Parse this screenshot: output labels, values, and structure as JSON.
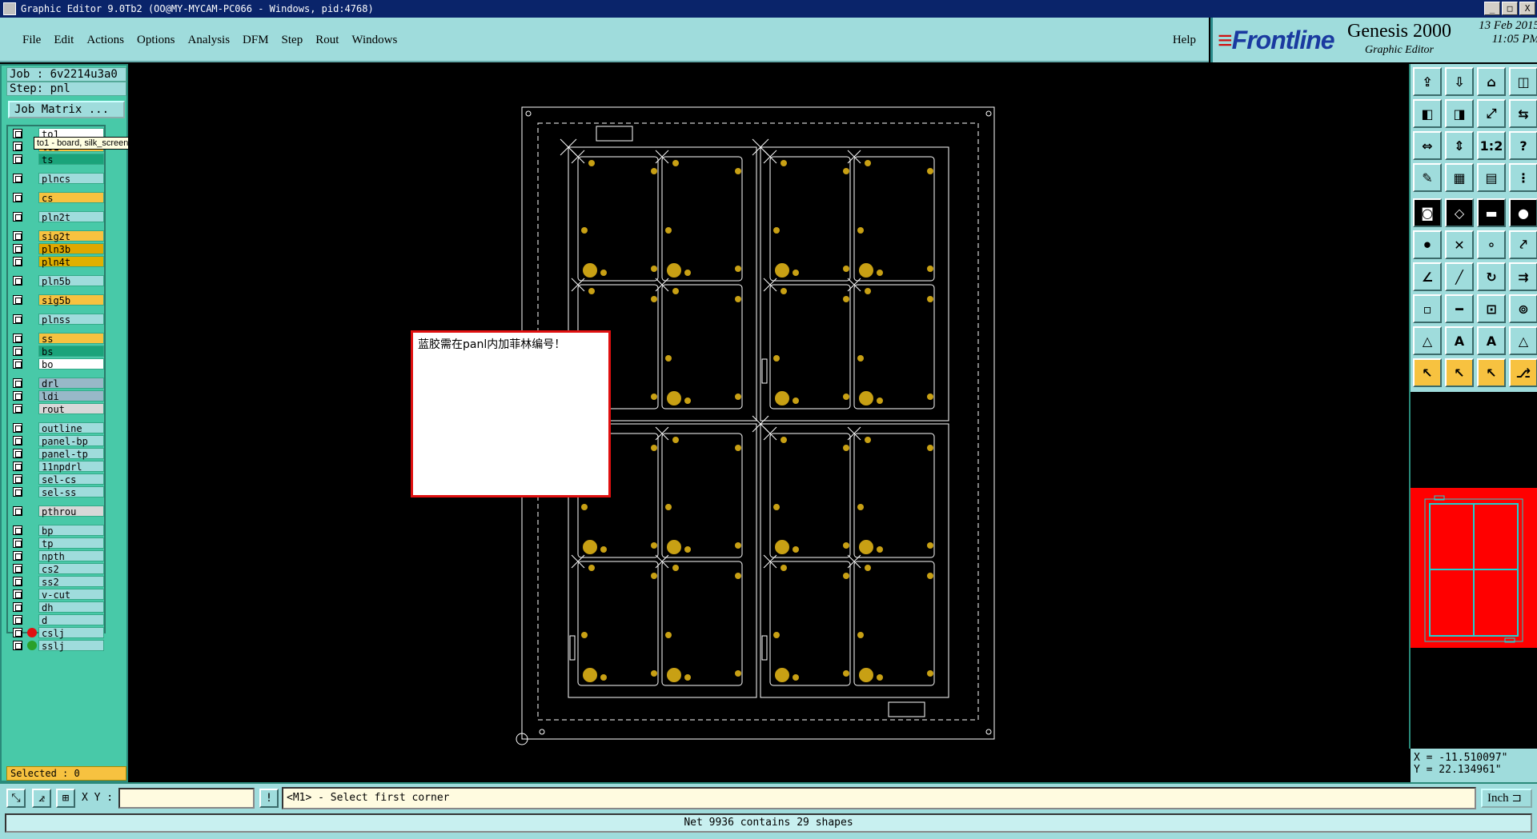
{
  "window": {
    "title": "Graphic Editor 9.0Tb2 (OO@MY-MYCAM-PC066 - Windows, pid:4768)",
    "controls": [
      "_",
      "□",
      "X"
    ]
  },
  "menu": {
    "items": [
      "File",
      "Edit",
      "Actions",
      "Options",
      "Analysis",
      "DFM",
      "Step",
      "Rout",
      "Windows"
    ],
    "help": "Help"
  },
  "brand": {
    "logo": "Frontline",
    "product": "Genesis 2000",
    "subtitle": "Graphic Editor",
    "date": "13 Feb 2015",
    "time": "11:05 PM"
  },
  "job": {
    "job_label": "Job : 6v2214u3a0",
    "step_label": "Step: pnl",
    "matrix_button": "Job Matrix ..."
  },
  "layers": [
    {
      "name": "to1",
      "color": "#ffffff",
      "gap": 0
    },
    {
      "name": "to1",
      "color": "#f7c240",
      "gap": 0
    },
    {
      "name": "ts",
      "color": "#1aa37a",
      "gap": 0
    },
    {
      "name": "plncs",
      "color": "#9fdcdc",
      "gap": 4
    },
    {
      "name": "cs",
      "color": "#f7c240",
      "gap": 4
    },
    {
      "name": "pln2t",
      "color": "#9fdcdc",
      "gap": 4
    },
    {
      "name": "sig2t",
      "color": "#f7c240",
      "gap": 4
    },
    {
      "name": "pln3b",
      "color": "#e0a800",
      "gap": 0
    },
    {
      "name": "pln4t",
      "color": "#e0b000",
      "gap": 0
    },
    {
      "name": "pln5b",
      "color": "#9fdcdc",
      "gap": 4
    },
    {
      "name": "sig5b",
      "color": "#f7c240",
      "gap": 4
    },
    {
      "name": "plnss",
      "color": "#9fdcdc",
      "gap": 4
    },
    {
      "name": "ss",
      "color": "#f7c240",
      "gap": 4
    },
    {
      "name": "bs",
      "color": "#1aa37a",
      "gap": 0
    },
    {
      "name": "bo",
      "color": "#ffffff",
      "gap": 0
    },
    {
      "name": "drl",
      "color": "#98b8c8",
      "gap": 4
    },
    {
      "name": "ldi",
      "color": "#98b8c8",
      "gap": 0
    },
    {
      "name": "rout",
      "color": "#d8d8d8",
      "gap": 0
    },
    {
      "name": "outline",
      "color": "#9fdcdc",
      "gap": 4
    },
    {
      "name": "panel-bp",
      "color": "#9fdcdc",
      "gap": 0
    },
    {
      "name": "panel-tp",
      "color": "#9fdcdc",
      "gap": 0
    },
    {
      "name": "11npdrl",
      "color": "#9fdcdc",
      "gap": 0
    },
    {
      "name": "sel-cs",
      "color": "#9fdcdc",
      "gap": 0
    },
    {
      "name": "sel-ss",
      "color": "#9fdcdc",
      "gap": 0
    },
    {
      "name": "pthrou",
      "color": "#d8d8d8",
      "gap": 4
    },
    {
      "name": "bp",
      "color": "#9fdcdc",
      "gap": 4
    },
    {
      "name": "tp",
      "color": "#9fdcdc",
      "gap": 0
    },
    {
      "name": "npth",
      "color": "#9fdcdc",
      "gap": 0
    },
    {
      "name": "cs2",
      "color": "#9fdcdc",
      "gap": 0
    },
    {
      "name": "ss2",
      "color": "#9fdcdc",
      "gap": 0
    },
    {
      "name": "v-cut",
      "color": "#9fdcdc",
      "gap": 0
    },
    {
      "name": "dh",
      "color": "#9fdcdc",
      "gap": 0
    },
    {
      "name": "d",
      "color": "#9fdcdc",
      "gap": 0
    },
    {
      "name": "cslj",
      "color": "#9fdcdc",
      "gap": 0,
      "dot": "#e01010"
    },
    {
      "name": "sslj",
      "color": "#9fdcdc",
      "gap": 0,
      "dot": "#2aa02a"
    }
  ],
  "tooltip": "to1 - board, silk_screen, positive",
  "selected": "Selected : 0",
  "note": {
    "text": "蓝胶需在panl内加菲林编号！",
    "border_color": "#e01010"
  },
  "coords": {
    "x": "X = -11.510097\"",
    "y": "Y = 22.134961\""
  },
  "bottom": {
    "xy_label": "X Y :",
    "xy_value": "",
    "alert_icon": "!",
    "prompt": "<M1> - Select first corner",
    "unit": "Inch"
  },
  "status": "Net 9936 contains 29 shapes",
  "colors": {
    "pad": "#c8a014",
    "board_outline": "#ffffff",
    "preview": "#ff0000",
    "preview_lines": "#20d0d0"
  },
  "tools": [
    "import-icon",
    "save-icon",
    "home-icon",
    "grid-layout-icon",
    "zoom-back-icon",
    "zoom-forward-icon",
    "zoom-in-icon",
    "swap-icon",
    "fit-width-icon",
    "fit-height-icon",
    "one-to-two-icon",
    "help-icon",
    "measure-icon",
    "grid-icon",
    "layer-colors-icon",
    "net-icon",
    "camera-icon",
    "polygon-icon",
    "ruler-icon",
    "dot-icon",
    "connect-icon",
    "cross-icon",
    "node-icon",
    "route-icon",
    "line-icon",
    "diagonal-icon",
    "arc-icon",
    "split-icon",
    "pad-icon",
    "minus-icon",
    "resize-icon",
    "circles-icon",
    "triangle-icon",
    "triangle-a-icon",
    "text-icon",
    "triangle-outline-icon",
    "pointer-icon",
    "select-icon",
    "rotate-select-icon",
    "path-icon"
  ]
}
